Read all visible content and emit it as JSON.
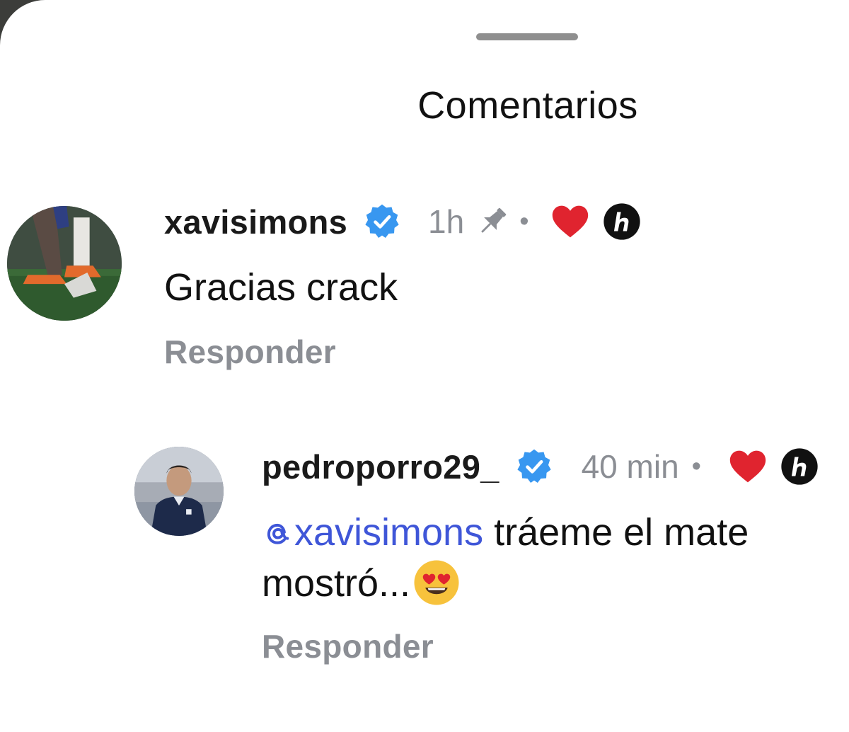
{
  "sheet": {
    "title": "Comentarios"
  },
  "comments": [
    {
      "username": "xavisimons",
      "verified": true,
      "time": "1h",
      "pinned": true,
      "separator": "•",
      "liked_by_author": true,
      "text": "Gracias crack",
      "reply_label": "Responder"
    },
    {
      "username": "pedroporro29_",
      "verified": true,
      "time": "40 min",
      "separator": "•",
      "liked_by_author": true,
      "mention": "xavisimons",
      "text": " tráeme el mate mostró...",
      "emoji": "heart-eyes",
      "reply_label": "Responder"
    }
  ],
  "colors": {
    "verified": "#3897f0",
    "heart": "#e0242f",
    "mention": "#3f56d8",
    "muted": "#8b8e94"
  }
}
